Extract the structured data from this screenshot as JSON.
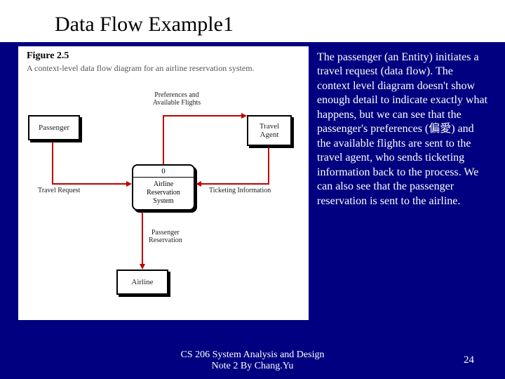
{
  "title": "Data Flow Example1",
  "figure": {
    "label": "Figure 2.5",
    "caption": "A context-level data flow diagram for an airline reservation system.",
    "entities": {
      "passenger": "Passenger",
      "travel_agent": "Travel\nAgent",
      "airline": "Airline"
    },
    "process": {
      "number": "0",
      "name": "Airline\nReservation\nSystem"
    },
    "flows": {
      "travel_request": "Travel Request",
      "prefs": "Preferences and\nAvailable Flights",
      "ticketing": "Ticketing Information",
      "reservation": "Passenger\nReservation"
    }
  },
  "body_text": "The passenger (an Entity) initiates a travel request (data flow). The context level diagram doesn't show enough detail to indicate exactly what happens, but we can see that the passenger's preferences (偏愛) and the available flights are sent to the travel agent, who sends ticketing information back to the process. We can also see that the passenger reservation is sent to the airline.",
  "footer": "CS 206 System Analysis and Design\nNote 2 By Chang.Yu",
  "page_number": "24"
}
